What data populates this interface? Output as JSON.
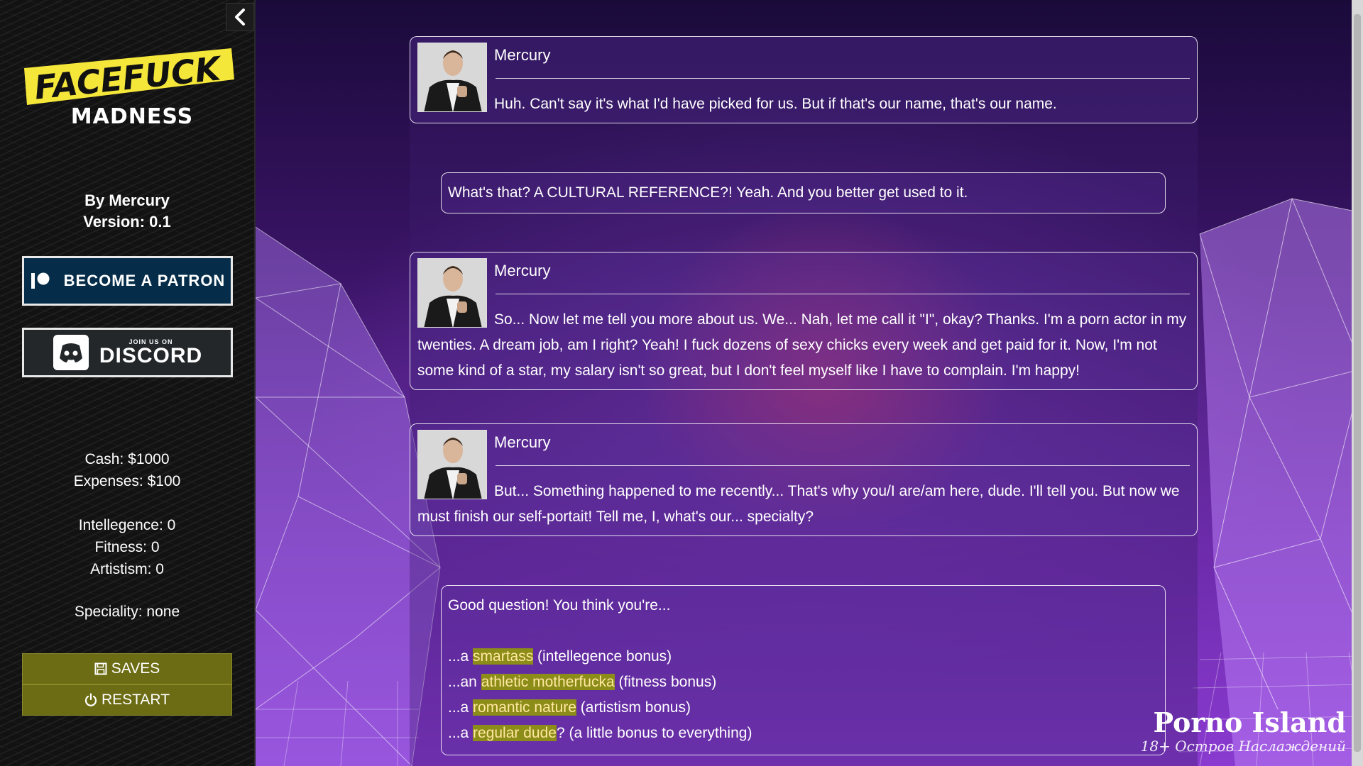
{
  "sidebar": {
    "logo": {
      "line1": "FACEFUCK",
      "line2": "MADNESS"
    },
    "author": "By Mercury",
    "version": "Version: 0.1",
    "patron_label": "BECOME A PATRON",
    "discord_small": "JOIN US ON",
    "discord_big": "DISCORD",
    "cash": "Cash: $1000",
    "expenses": "Expenses: $100",
    "intellegence": "Intellegence: 0",
    "fitness": "Fitness: 0",
    "artistism": "Artistism: 0",
    "speciality": "Speciality: none",
    "saves_label": "SAVES",
    "restart_label": "RESTART",
    "colors": {
      "menu_button": "#6c6c14",
      "patron": "#052d49",
      "discord": "#23272a"
    }
  },
  "story": {
    "msg1": {
      "speaker": "Mercury",
      "text": "Huh. Can't say it's what I'd have picked for us. But if that's our name, that's our name."
    },
    "msg2": {
      "text": "What's that? A CULTURAL REFERENCE?! Yeah. And you better get used to it."
    },
    "msg3": {
      "speaker": "Mercury",
      "text": "So... Now let me tell you more about us. We... Nah, let me call it \"I\", okay? Thanks. I'm a porn actor in my twenties. A dream job, am I right? Yeah! I fuck dozens of sexy chicks every week and get paid for it. Now, I'm not some kind of a star, my salary isn't so great, but I don't feel myself like I have to complain. I'm happy!"
    },
    "msg4": {
      "speaker": "Mercury",
      "text": "But... Something happened to me recently... That's why you/I are/am here, dude. I'll tell you. But now we must finish our self-portait! Tell me, I, what's our... specialty?"
    },
    "msg5": {
      "question": "Good question! You think you're...",
      "choices": [
        {
          "prefix": "...a ",
          "link": "smartass",
          "suffix": " (intellegence bonus)"
        },
        {
          "prefix": "...an ",
          "link": "athletic motherfucka",
          "suffix": " (fitness bonus)"
        },
        {
          "prefix": "...a ",
          "link": "romantic nature",
          "suffix": " (artistism bonus)"
        },
        {
          "prefix": "...a ",
          "link": "regular dude",
          "suffix": "? (a little bonus to everything)"
        }
      ]
    }
  },
  "watermark": {
    "line1": "Porno Island",
    "line2": "18+ Остров Наслаждений"
  },
  "icons": [
    "chevron-left-icon",
    "patreon-icon",
    "discord-icon",
    "floppy-icon",
    "power-icon",
    "avatar-portrait"
  ]
}
